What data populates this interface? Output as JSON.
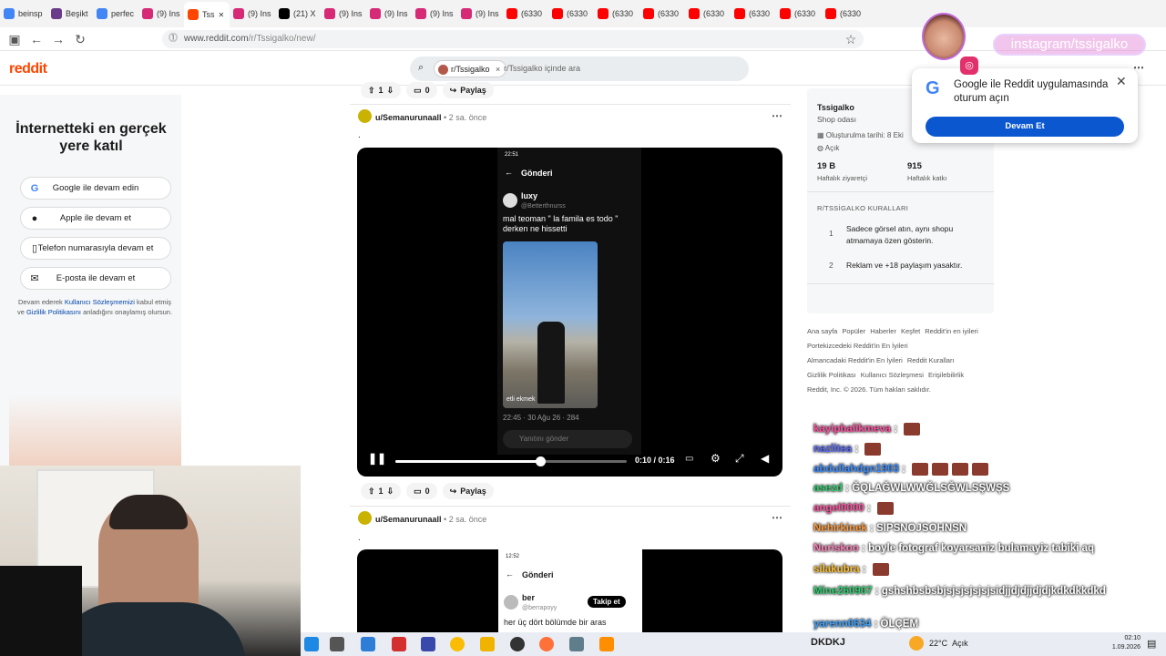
{
  "browser": {
    "tabs": [
      {
        "label": "beinsp",
        "icon": "google-icon",
        "color": "#4285f4"
      },
      {
        "label": "Beşikt",
        "icon": "site-icon",
        "color": "#6a3b8a"
      },
      {
        "label": "perfec",
        "icon": "google-icon",
        "color": "#4285f4"
      },
      {
        "label": "(9) Ins",
        "icon": "instagram-icon",
        "color": "#d62976"
      },
      {
        "label": "Tss",
        "icon": "reddit-icon",
        "color": "#ff4500",
        "active": true
      },
      {
        "label": "(9) Ins",
        "icon": "instagram-icon",
        "color": "#d62976"
      },
      {
        "label": "(21) X",
        "icon": "x-icon",
        "color": "#000000"
      },
      {
        "label": "(9) Ins",
        "icon": "instagram-icon",
        "color": "#d62976"
      },
      {
        "label": "(9) Ins",
        "icon": "instagram-icon",
        "color": "#d62976"
      },
      {
        "label": "(9) Ins",
        "icon": "instagram-icon",
        "color": "#d62976"
      },
      {
        "label": "(9) Ins",
        "icon": "instagram-icon",
        "color": "#d62976"
      },
      {
        "label": "(6330",
        "icon": "youtube-icon",
        "color": "#ff0000"
      },
      {
        "label": "(6330",
        "icon": "youtube-icon",
        "color": "#ff0000"
      },
      {
        "label": "(6330",
        "icon": "youtube-icon",
        "color": "#ff0000"
      },
      {
        "label": "(6330",
        "icon": "youtube-icon",
        "color": "#ff0000"
      },
      {
        "label": "(6330",
        "icon": "youtube-icon",
        "color": "#ff0000"
      },
      {
        "label": "(6330",
        "icon": "youtube-icon",
        "color": "#ff0000"
      },
      {
        "label": "(6330",
        "icon": "youtube-icon",
        "color": "#ff0000"
      },
      {
        "label": "(6330",
        "icon": "youtube-icon",
        "color": "#ff0000"
      }
    ],
    "url_host": "www.reddit.com",
    "url_path": "/r/Tssigalko/new/"
  },
  "reddit": {
    "logo": "reddit",
    "search_chip": "r/Tssigalko",
    "search_placeholder": "r/Tssigalko içinde ara"
  },
  "left_panel": {
    "title": "İnternetteki en gerçek yere katıl",
    "buttons": [
      {
        "label": "Google ile devam edin",
        "icon": "google-icon"
      },
      {
        "label": "Apple ile devam et",
        "icon": "apple-icon"
      },
      {
        "label": "Telefon numarasıyla devam et",
        "icon": "phone-icon"
      },
      {
        "label": "E-posta ile devam et",
        "icon": "mail-icon"
      }
    ],
    "legal_1": "Devam ederek ",
    "legal_link1": "Kullanıcı Sözleşmemizi",
    "legal_2": " kabul etmiş ve ",
    "legal_link2": "Gizlilik Politikasını",
    "legal_3": " anladığını onaylamış olursun."
  },
  "top_actions": {
    "votes": "1",
    "comments": "0",
    "share": "Paylaş"
  },
  "post1": {
    "author": "u/Semanurunaall",
    "age": "2 sa. önce",
    "body": ".",
    "phone": {
      "time": "22:51",
      "header": "Gönderi",
      "user": "luxy",
      "handle": "@Betterthnurss",
      "text": "mal teoman \" la famila es todo \" derken ne hissetti",
      "photo_caption": "etli ekmek",
      "meta": "22:45 · 30 Ağu 26 · 284",
      "reply": "Yanıtını gönder"
    },
    "video": {
      "current": "0:10",
      "total": "0:16",
      "progress": 0.625
    },
    "votes": "1",
    "comments": "0",
    "share": "Paylaş"
  },
  "post2": {
    "author": "u/Semanurunaall",
    "age": "2 sa. önce",
    "body": ".",
    "phone": {
      "time": "12:52",
      "header": "Gönderi",
      "user": "ber",
      "handle": "@berrapoyy",
      "follow": "Takip et",
      "text": "her üç dört bölümde bir aras"
    }
  },
  "sidebar": {
    "name": "Tssigalko",
    "description": "Shop odası",
    "created": "Oluşturulma tarihi: 8 Eki",
    "visibility": "Açık",
    "stat1_value": "19 B",
    "stat1_label": "Haftalık ziyaretçi",
    "stat2_value": "915",
    "stat2_label": "Haftalık katkı",
    "rules_title": "R/TSSİGALKO KURALLARI",
    "rules": [
      {
        "num": "1",
        "text": "Sadece görsel atın, aynı shopu atmamaya özen gösterin."
      },
      {
        "num": "2",
        "text": "Reklam ve +18 paylaşım yasaktır."
      }
    ]
  },
  "footer": {
    "links": [
      "Ana sayfa",
      "Popüler",
      "Haberler",
      "Keşfet",
      "Reddit'in en iyileri",
      "Portekizcedeki Reddit'in En İyileri",
      "Almancadaki Reddit'in En İyileri",
      "Reddit Kuralları",
      "Gizlilik Politikası",
      "Kullanıcı Sözleşmesi",
      "Erişilebilirlik"
    ],
    "copyright": "Reddit, Inc. © 2026. Tüm hakları saklıdır."
  },
  "google_popup": {
    "title": "Google ile Reddit uygulamasında oturum açın",
    "button": "Devam Et"
  },
  "overlay": {
    "instagram": "instagram/tssigalko"
  },
  "chat": [
    {
      "user": "kayipbalikmeva",
      "msg": "",
      "color": "#ff4fa0",
      "emotes": 1
    },
    {
      "user": "nazlitea",
      "msg": "",
      "color": "#5a6bff",
      "emotes": 1
    },
    {
      "user": "abdullahdgn1903",
      "msg": "",
      "color": "#3a8cff",
      "emotes": 4
    },
    {
      "user": "asezd",
      "msg": "ĞQLAĞWLWWĞLSĞWLSŞWŞS",
      "color": "#2fd06f",
      "emotes": 0
    },
    {
      "user": "angel0000",
      "msg": "",
      "color": "#ff4fa0",
      "emotes": 1
    },
    {
      "user": "Nehirkinek",
      "msg": "SIPSNOJSOHNSN",
      "color": "#ff9a3a",
      "emotes": 0
    },
    {
      "user": "Nuriskoo",
      "msg": "boyle fotograf koyarsaniz bulamayiz tabiki aq",
      "color": "#ff7fb8",
      "emotes": 0
    },
    {
      "user": "silakubra",
      "msg": "",
      "color": "#ffbf2f",
      "emotes": 1
    },
    {
      "user": "Mine260907",
      "msg": "gshshbsbsbjsjsjsjsjsjsidjjdjdjjdjdjkdkdkkdkd",
      "color": "#2fd06f",
      "emotes": 0
    },
    {
      "user": "yarenn0634",
      "msg": "ÖLÇEM",
      "color": "#3aa0ff",
      "emotes": 0
    }
  ],
  "taskbar": {
    "ticker": "DKDKJ",
    "weather": "22°C",
    "weather_desc": "Açık",
    "time": "02:10",
    "date": "1.09.2026"
  }
}
